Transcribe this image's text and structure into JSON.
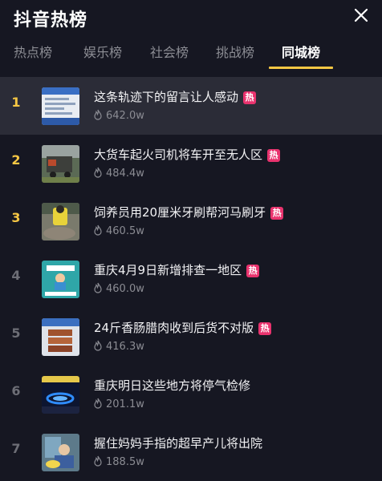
{
  "header": {
    "title": "抖音热榜",
    "close_icon": "close-icon"
  },
  "tabs": [
    {
      "label": "热点榜",
      "active": false
    },
    {
      "label": "娱乐榜",
      "active": false
    },
    {
      "label": "社会榜",
      "active": false
    },
    {
      "label": "挑战榜",
      "active": false
    },
    {
      "label": "同城榜",
      "active": true
    }
  ],
  "colors": {
    "accent": "#f6c744",
    "hot_badge": "#e9336e",
    "background": "#161722",
    "highlight_row": "#2b2c37"
  },
  "list": {
    "hot_label": "热",
    "items": [
      {
        "rank": "1",
        "title": "这条轨迹下的留言让人感动",
        "hot": true,
        "count": "642.0w"
      },
      {
        "rank": "2",
        "title": "大货车起火司机将车开至无人区",
        "hot": true,
        "count": "484.4w"
      },
      {
        "rank": "3",
        "title": "饲养员用20厘米牙刷帮河马刷牙",
        "hot": true,
        "count": "460.5w"
      },
      {
        "rank": "4",
        "title": "重庆4月9日新增排查一地区",
        "hot": true,
        "count": "460.0w"
      },
      {
        "rank": "5",
        "title": "24斤香肠腊肉收到后货不对版",
        "hot": true,
        "count": "416.3w"
      },
      {
        "rank": "6",
        "title": "重庆明日这些地方将停气检修",
        "hot": false,
        "count": "201.1w"
      },
      {
        "rank": "7",
        "title": "握住妈妈手指的超早产儿将出院",
        "hot": false,
        "count": "188.5w"
      }
    ]
  }
}
